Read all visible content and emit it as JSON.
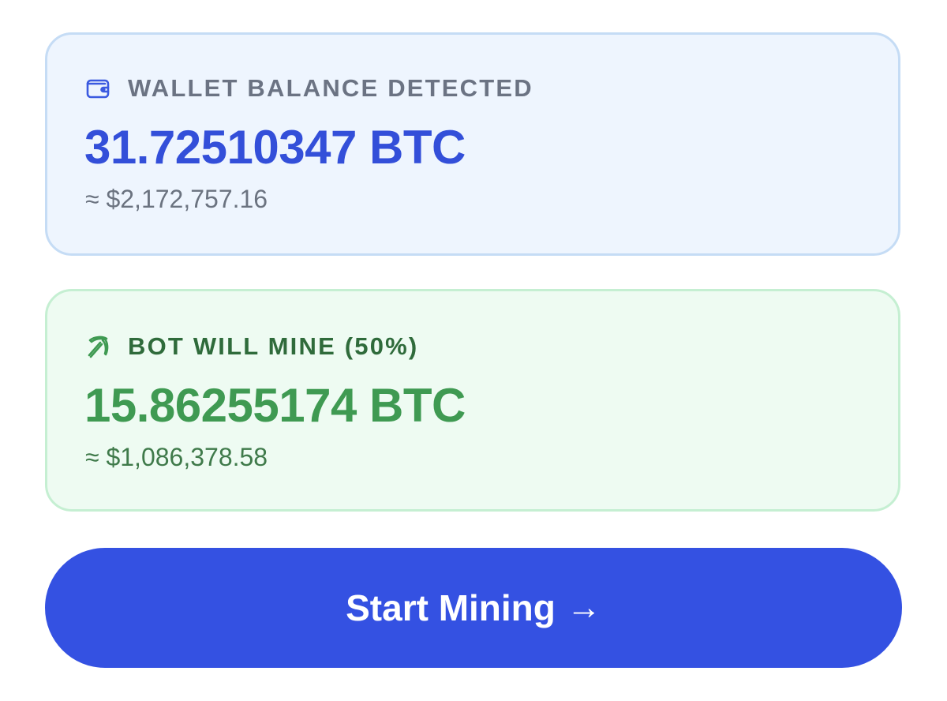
{
  "wallet_card": {
    "icon": "wallet-icon",
    "label": "WALLET BALANCE DETECTED",
    "amount": "31.72510347 BTC",
    "fiat": "≈ $2,172,757.16",
    "accent_color": "#334fd9"
  },
  "mine_card": {
    "icon": "pickaxe-icon",
    "label": "BOT WILL MINE (50%)",
    "amount": "15.86255174 BTC",
    "fiat": "≈ $1,086,378.58",
    "accent_color": "#3f9a52"
  },
  "cta": {
    "label": "Start Mining",
    "arrow": "→",
    "color": "#3451e2"
  }
}
